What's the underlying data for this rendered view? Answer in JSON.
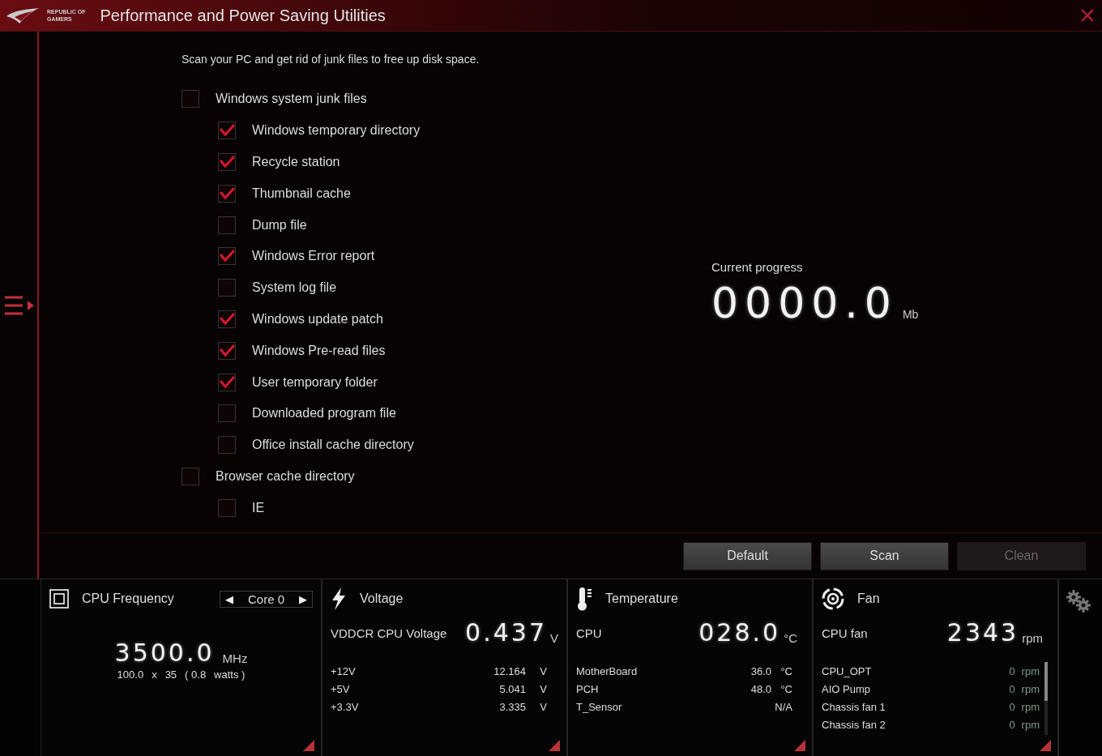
{
  "window": {
    "logo": [
      "REPUBLIC OF",
      "GAMERS"
    ],
    "title": "Performance and Power Saving Utilities"
  },
  "intro": "Scan your PC and get rid of junk files to free up disk space.",
  "checklist": [
    {
      "label": "Windows system junk files",
      "checked": false,
      "children": [
        {
          "label": "Windows temporary directory",
          "checked": true
        },
        {
          "label": "Recycle station",
          "checked": true
        },
        {
          "label": "Thumbnail cache",
          "checked": true
        },
        {
          "label": "Dump file",
          "checked": false
        },
        {
          "label": "Windows Error report",
          "checked": true
        },
        {
          "label": "System log file",
          "checked": false
        },
        {
          "label": "Windows update patch",
          "checked": true
        },
        {
          "label": "Windows Pre-read files",
          "checked": true
        },
        {
          "label": "User temporary folder",
          "checked": true
        },
        {
          "label": "Downloaded program file",
          "checked": false
        },
        {
          "label": "Office install cache directory",
          "checked": false
        }
      ]
    },
    {
      "label": "Browser cache directory",
      "checked": false,
      "children": [
        {
          "label": "IE",
          "checked": false
        }
      ]
    }
  ],
  "progress": {
    "label": "Current progress",
    "value": "0000.0",
    "unit": "Mb"
  },
  "buttons": [
    {
      "label": "Default",
      "disabled": false
    },
    {
      "label": "Scan",
      "disabled": false
    },
    {
      "label": "Clean",
      "disabled": true
    }
  ],
  "cpu_frequency": {
    "title": "CPU Frequency",
    "core_selector": {
      "prev": "◀",
      "value": "Core 0",
      "next": "▶"
    },
    "value": "3500.0",
    "unit": "MHz",
    "detail": [
      "100.0",
      "x",
      "35",
      "( 0.8",
      "watts )"
    ]
  },
  "voltage": {
    "title": "Voltage",
    "main_label": "VDDCR CPU Voltage",
    "main_value": "0.437",
    "main_unit": "V",
    "rows": [
      {
        "name": "+12V",
        "value": "12.164",
        "unit": "V"
      },
      {
        "name": "+5V",
        "value": "5.041",
        "unit": "V"
      },
      {
        "name": "+3.3V",
        "value": "3.335",
        "unit": "V"
      }
    ]
  },
  "temperature": {
    "title": "Temperature",
    "main_label": "CPU",
    "main_value": "028.0",
    "main_unit": "°C",
    "rows": [
      {
        "name": "MotherBoard",
        "value": "36.0",
        "unit": "°C"
      },
      {
        "name": "PCH",
        "value": "48.0",
        "unit": "°C"
      },
      {
        "name": "T_Sensor",
        "value": "N/A",
        "unit": ""
      }
    ]
  },
  "fan": {
    "title": "Fan",
    "main_label": "CPU fan",
    "main_value": "2343",
    "main_unit": "rpm",
    "rows": [
      {
        "name": "CPU_OPT",
        "value": "0",
        "unit": "rpm"
      },
      {
        "name": "AIO Pump",
        "value": "0",
        "unit": "rpm"
      },
      {
        "name": "Chassis fan 1",
        "value": "0",
        "unit": "rpm"
      },
      {
        "name": "Chassis fan 2",
        "value": "0",
        "unit": "rpm"
      }
    ]
  }
}
